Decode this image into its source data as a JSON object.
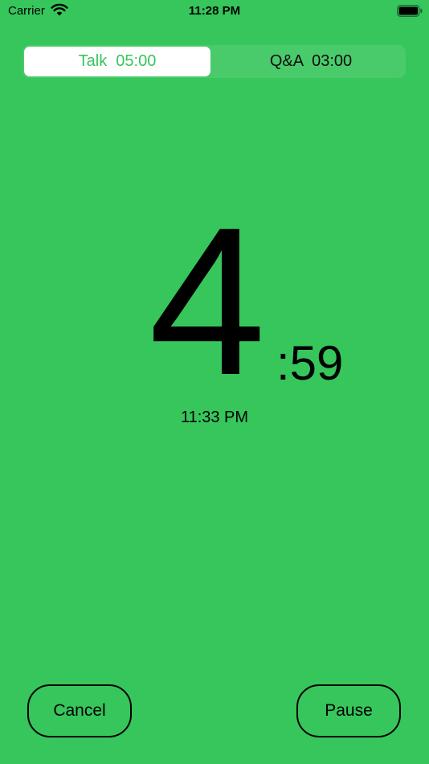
{
  "status_bar": {
    "carrier": "Carrier",
    "time": "11:28 PM",
    "wifi_icon": "wifi-icon",
    "battery_icon": "battery-icon"
  },
  "segments": [
    {
      "label": "Talk  05:00",
      "selected": true
    },
    {
      "label": "Q&A  03:00",
      "selected": false
    }
  ],
  "timer": {
    "minutes": "4",
    "seconds": ":59",
    "end_time": "11:33 PM"
  },
  "buttons": {
    "cancel_label": "Cancel",
    "pause_label": "Pause"
  },
  "colors": {
    "background": "#36c65b",
    "selected_segment_text": "#36c65b",
    "selected_segment_bg": "#ffffff"
  }
}
